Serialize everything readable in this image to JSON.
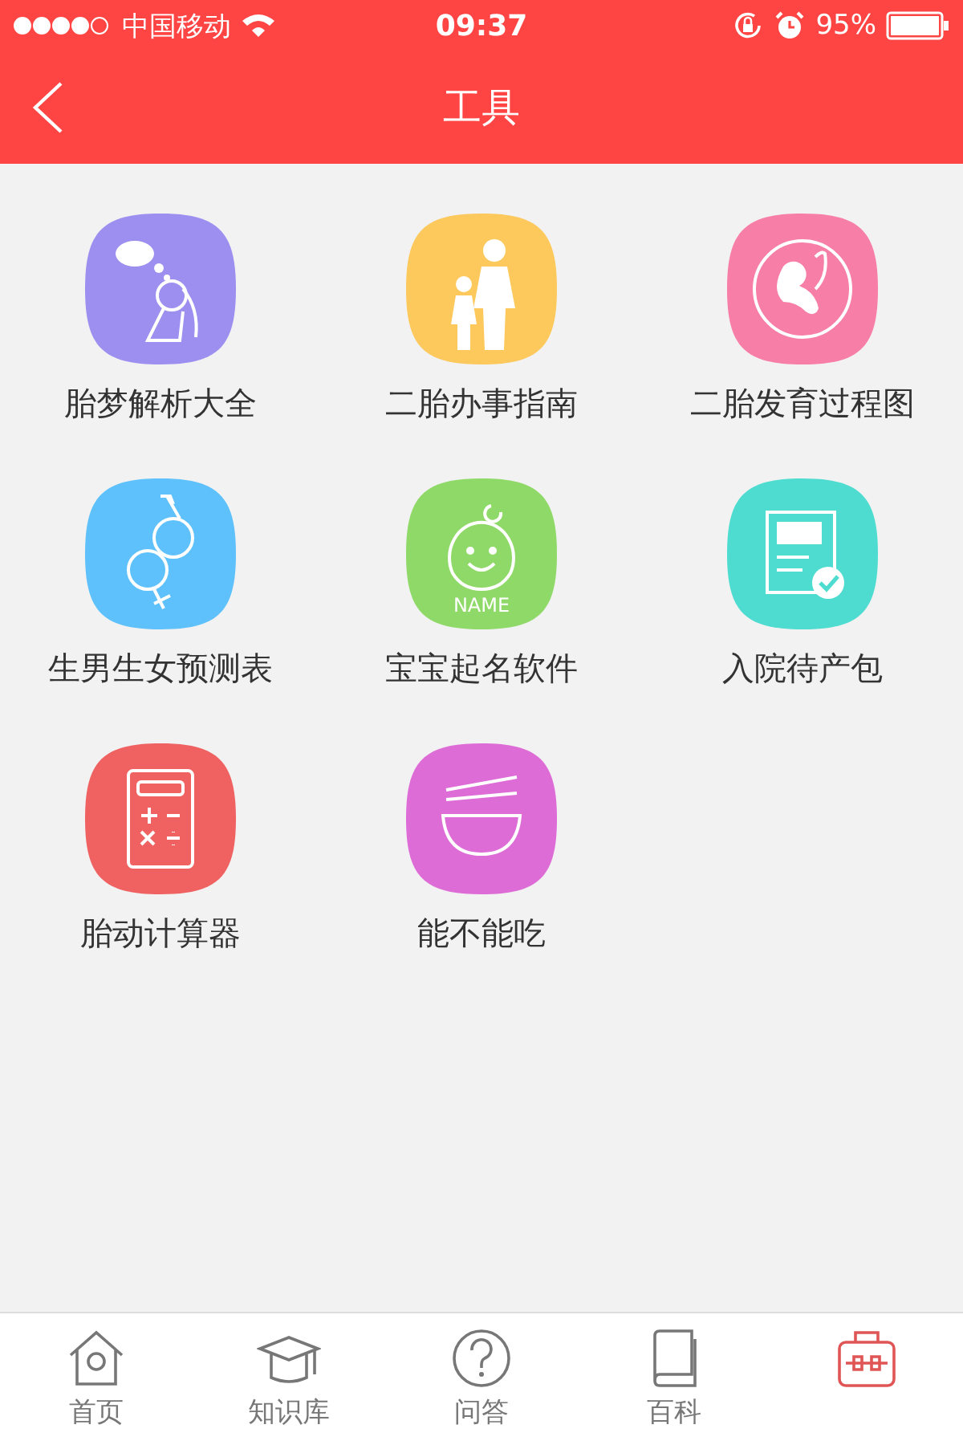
{
  "status_bar": {
    "carrier": "中国移动",
    "time": "09:37",
    "battery": "95%"
  },
  "nav": {
    "title": "工具"
  },
  "tools": [
    {
      "label": "胎梦解析大全",
      "kind": "dream",
      "color": "#9d8ff0"
    },
    {
      "label": "二胎办事指南",
      "kind": "family",
      "color": "#fdc85c"
    },
    {
      "label": "二胎发育过程图",
      "kind": "fetus",
      "color": "#f77ea6"
    },
    {
      "label": "生男生女预测表",
      "kind": "gender",
      "color": "#5ec1fb"
    },
    {
      "label": "宝宝起名软件",
      "kind": "baby",
      "color": "#8fd968",
      "icon_text": "NAME"
    },
    {
      "label": "入院待产包",
      "kind": "checklist",
      "color": "#4fdcd0"
    },
    {
      "label": "胎动计算器",
      "kind": "calculator",
      "color": "#f06262"
    },
    {
      "label": "能不能吃",
      "kind": "bowl",
      "color": "#dd6cd6"
    }
  ],
  "tab_bar": [
    {
      "label": "首页",
      "kind": "home",
      "selected": false
    },
    {
      "label": "知识库",
      "kind": "cap",
      "selected": false
    },
    {
      "label": "问答",
      "kind": "question",
      "selected": false
    },
    {
      "label": "百科",
      "kind": "book",
      "selected": false
    },
    {
      "kind": "toolbox",
      "selected": true
    }
  ]
}
